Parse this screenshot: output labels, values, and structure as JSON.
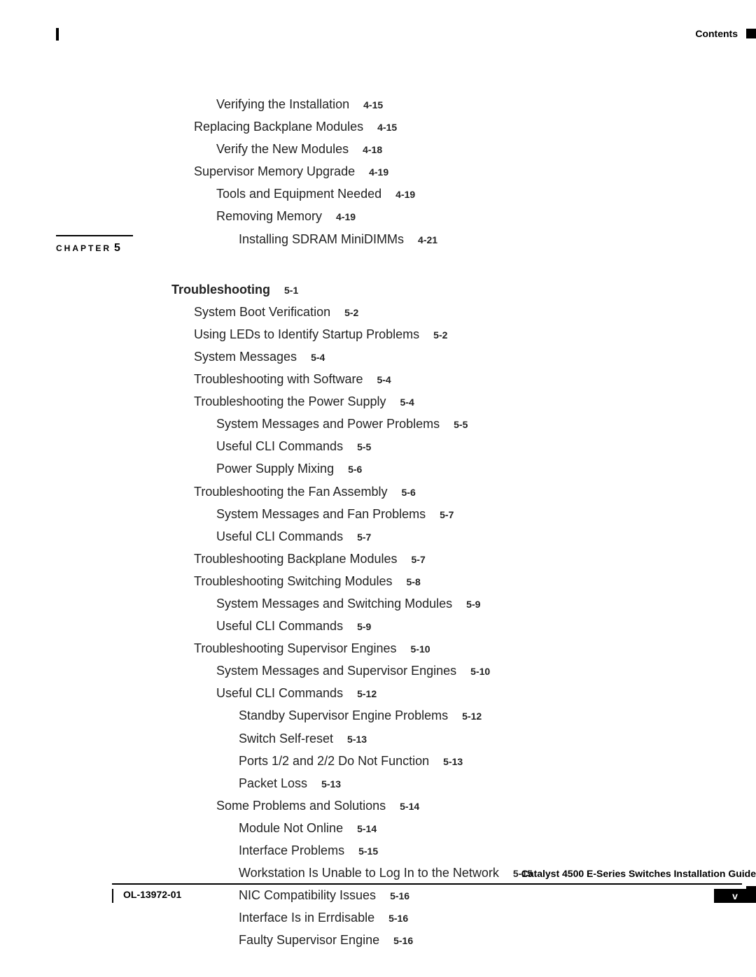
{
  "header": {
    "label": "Contents"
  },
  "chapter": {
    "label": "CHAPTER",
    "num": "5"
  },
  "toc": [
    {
      "lvl": 2,
      "title": "Verifying the Installation",
      "page": "4-15",
      "bold": false
    },
    {
      "lvl": 1,
      "title": "Replacing Backplane Modules",
      "page": "4-15",
      "bold": false
    },
    {
      "lvl": 2,
      "title": "Verify the New Modules",
      "page": "4-18",
      "bold": false
    },
    {
      "lvl": 1,
      "title": "Supervisor Memory Upgrade",
      "page": "4-19",
      "bold": false
    },
    {
      "lvl": 2,
      "title": "Tools and Equipment Needed",
      "page": "4-19",
      "bold": false
    },
    {
      "lvl": 2,
      "title": "Removing Memory",
      "page": "4-19",
      "bold": false
    },
    {
      "lvl": 3,
      "title": "Installing SDRAM MiniDIMMs",
      "page": "4-21",
      "bold": false
    },
    {
      "gap": true
    },
    {
      "lvl": 0,
      "title": "Troubleshooting",
      "page": "5-1",
      "bold": true
    },
    {
      "lvl": 1,
      "title": "System Boot Verification",
      "page": "5-2",
      "bold": false
    },
    {
      "lvl": 1,
      "title": "Using LEDs to Identify Startup Problems",
      "page": "5-2",
      "bold": false
    },
    {
      "lvl": 1,
      "title": "System Messages",
      "page": "5-4",
      "bold": false
    },
    {
      "lvl": 1,
      "title": "Troubleshooting with Software",
      "page": "5-4",
      "bold": false
    },
    {
      "lvl": 1,
      "title": "Troubleshooting the Power Supply",
      "page": "5-4",
      "bold": false
    },
    {
      "lvl": 2,
      "title": "System Messages and Power Problems",
      "page": "5-5",
      "bold": false
    },
    {
      "lvl": 2,
      "title": "Useful CLI Commands",
      "page": "5-5",
      "bold": false
    },
    {
      "lvl": 2,
      "title": "Power Supply Mixing",
      "page": "5-6",
      "bold": false
    },
    {
      "lvl": 1,
      "title": "Troubleshooting the Fan Assembly",
      "page": "5-6",
      "bold": false
    },
    {
      "lvl": 2,
      "title": "System Messages and Fan Problems",
      "page": "5-7",
      "bold": false
    },
    {
      "lvl": 2,
      "title": "Useful CLI Commands",
      "page": "5-7",
      "bold": false
    },
    {
      "lvl": 1,
      "title": "Troubleshooting Backplane Modules",
      "page": "5-7",
      "bold": false
    },
    {
      "lvl": 1,
      "title": "Troubleshooting Switching Modules",
      "page": "5-8",
      "bold": false
    },
    {
      "lvl": 2,
      "title": "System Messages and Switching Modules",
      "page": "5-9",
      "bold": false
    },
    {
      "lvl": 2,
      "title": "Useful CLI Commands",
      "page": "5-9",
      "bold": false
    },
    {
      "lvl": 1,
      "title": "Troubleshooting Supervisor Engines",
      "page": "5-10",
      "bold": false
    },
    {
      "lvl": 2,
      "title": "System Messages and Supervisor Engines",
      "page": "5-10",
      "bold": false
    },
    {
      "lvl": 2,
      "title": "Useful CLI Commands",
      "page": "5-12",
      "bold": false
    },
    {
      "lvl": 3,
      "title": "Standby Supervisor Engine Problems",
      "page": "5-12",
      "bold": false
    },
    {
      "lvl": 3,
      "title": "Switch Self-reset",
      "page": "5-13",
      "bold": false
    },
    {
      "lvl": 3,
      "title": "Ports 1/2 and 2/2 Do Not Function",
      "page": "5-13",
      "bold": false
    },
    {
      "lvl": 3,
      "title": "Packet Loss",
      "page": "5-13",
      "bold": false
    },
    {
      "lvl": 2,
      "title": "Some Problems and Solutions",
      "page": "5-14",
      "bold": false
    },
    {
      "lvl": 3,
      "title": "Module Not Online",
      "page": "5-14",
      "bold": false
    },
    {
      "lvl": 3,
      "title": "Interface Problems",
      "page": "5-15",
      "bold": false
    },
    {
      "lvl": 3,
      "title": "Workstation Is Unable to Log In to the Network",
      "page": "5-15",
      "bold": false
    },
    {
      "lvl": 3,
      "title": "NIC Compatibility Issues",
      "page": "5-16",
      "bold": false
    },
    {
      "lvl": 3,
      "title": "Interface Is in Errdisable",
      "page": "5-16",
      "bold": false
    },
    {
      "lvl": 3,
      "title": "Faulty Supervisor Engine",
      "page": "5-16",
      "bold": false
    }
  ],
  "footer": {
    "guide": "Catalyst 4500 E-Series Switches Installation Guide",
    "ol": "OL-13972-01",
    "page": "v"
  }
}
